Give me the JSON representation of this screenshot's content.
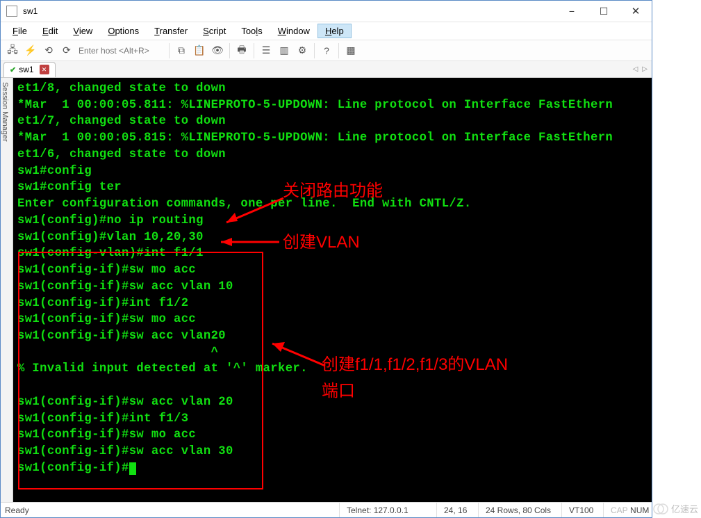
{
  "window": {
    "title": "sw1"
  },
  "menu": {
    "file": "File",
    "edit": "Edit",
    "view": "View",
    "options": "Options",
    "transfer": "Transfer",
    "script": "Script",
    "tools": "Tools",
    "window": "Window",
    "help": "Help"
  },
  "toolbar": {
    "host_placeholder": "Enter host <Alt+R>"
  },
  "tab": {
    "label": "sw1"
  },
  "side": {
    "label": "Session Manager"
  },
  "terminal_lines": [
    "et1/8, changed state to down",
    "*Mar  1 00:00:05.811: %LINEPROTO-5-UPDOWN: Line protocol on Interface FastEthern",
    "et1/7, changed state to down",
    "*Mar  1 00:00:05.815: %LINEPROTO-5-UPDOWN: Line protocol on Interface FastEthern",
    "et1/6, changed state to down",
    "sw1#config",
    "sw1#config ter",
    "Enter configuration commands, one per line.  End with CNTL/Z.",
    "sw1(config)#no ip routing",
    "sw1(config)#vlan 10,20,30",
    "sw1(config-vlan)#int f1/1",
    "sw1(config-if)#sw mo acc",
    "sw1(config-if)#sw acc vlan 10",
    "sw1(config-if)#int f1/2",
    "sw1(config-if)#sw mo acc",
    "sw1(config-if)#sw acc vlan20",
    "                          ^",
    "% Invalid input detected at '^' marker.",
    "",
    "sw1(config-if)#sw acc vlan 20",
    "sw1(config-if)#int f1/3",
    "sw1(config-if)#sw mo acc",
    "sw1(config-if)#sw acc vlan 30",
    "sw1(config-if)#"
  ],
  "status": {
    "ready": "Ready",
    "telnet": "Telnet: 127.0.0.1",
    "pos": "24,  16",
    "size": "24 Rows, 80 Cols",
    "emu": "VT100",
    "cap": "CAP",
    "num": "NUM"
  },
  "annotations": {
    "a1": "关闭路由功能",
    "a2": "创建VLAN",
    "a3": "创建f1/1,f1/2,f1/3的VLAN端口"
  },
  "watermark": "亿速云"
}
